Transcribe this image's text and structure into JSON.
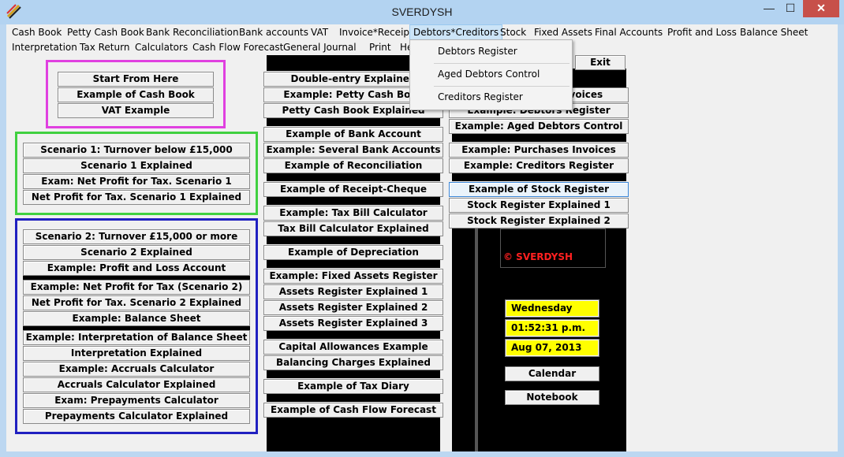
{
  "window": {
    "title": "SVERDYSH",
    "min_label": "—",
    "max_label": "☐",
    "close_label": "✕"
  },
  "menu": {
    "items": [
      "Cash Book",
      "Petty Cash Book",
      "Bank Reconciliation",
      "Bank accounts",
      "VAT",
      "Invoice*Receipt",
      "Debtors*Creditors",
      "Stock",
      "Fixed Assets",
      "Final Accounts",
      "Profit and Loss",
      "Balance Sheet",
      "Interpretation",
      "Tax Return",
      "Calculators",
      "Cash Flow Forecast",
      "General Journal",
      "Print",
      "He"
    ]
  },
  "dropdown": {
    "items": [
      "Debtors Register",
      "Aged Debtors Control",
      "Creditors Register"
    ]
  },
  "col1": {
    "group1": [
      "Start From Here",
      "Example of Cash Book",
      "VAT Example"
    ],
    "group2": [
      "Scenario 1: Turnover below £15,000",
      "Scenario 1 Explained",
      "Exam: Net Profit for Tax. Scenario 1",
      "Net Profit for Tax. Scenario 1 Explained"
    ],
    "group3": [
      "Scenario 2: Turnover £15,000 or more",
      "Scenario 2 Explained",
      "Example: Profit and Loss Account",
      "Example: Net Profit for Tax (Scenario 2)",
      "Net Profit for Tax. Scenario 2 Explained",
      "Example: Balance Sheet",
      "Example: Interpretation of Balance Sheet",
      "Interpretation Explained",
      "Example: Accruals Calculator",
      "Accruals Calculator Explained",
      "Exam: Prepayments Calculator",
      "Prepayments Calculator Explained"
    ]
  },
  "col2": [
    "Double-entry Explained",
    "Example: Petty Cash Book",
    "Petty Cash Book Explained",
    "Example of Bank Account",
    "Example: Several Bank Accounts",
    "Example of Reconciliation",
    "Example of Receipt-Cheque",
    "Example: Tax Bill Calculator",
    "Tax Bill Calculator Explained",
    "Example of Depreciation",
    "Example: Fixed Assets Register",
    "Assets Register Explained 1",
    "Assets Register Explained 2",
    "Assets Register Explained 3",
    "Capital Allowances Example",
    "Balancing Charges Explained",
    "Example of Tax Diary",
    "Example of Cash Flow Forecast"
  ],
  "col3": [
    "Exit",
    "Example: Sales Invoices",
    "Example: Debtors Register",
    "Example: Aged Debtors Control",
    "Example: Purchases Invoices",
    "Example: Creditors Register",
    "Example of Stock Register",
    "Stock Register Explained 1",
    "Stock Register Explained 2"
  ],
  "panel": {
    "copyright": "© SVERDYSH",
    "day": "Wednesday",
    "time": "01:52:31 p.m.",
    "date": "Aug 07, 2013",
    "calendar": "Calendar",
    "notebook": "Notebook"
  },
  "colors": {
    "frame1": "#e040e0",
    "frame2": "#40d040",
    "frame3": "#2020c0",
    "close": "#c7504a",
    "highlight": "#ffff00"
  }
}
